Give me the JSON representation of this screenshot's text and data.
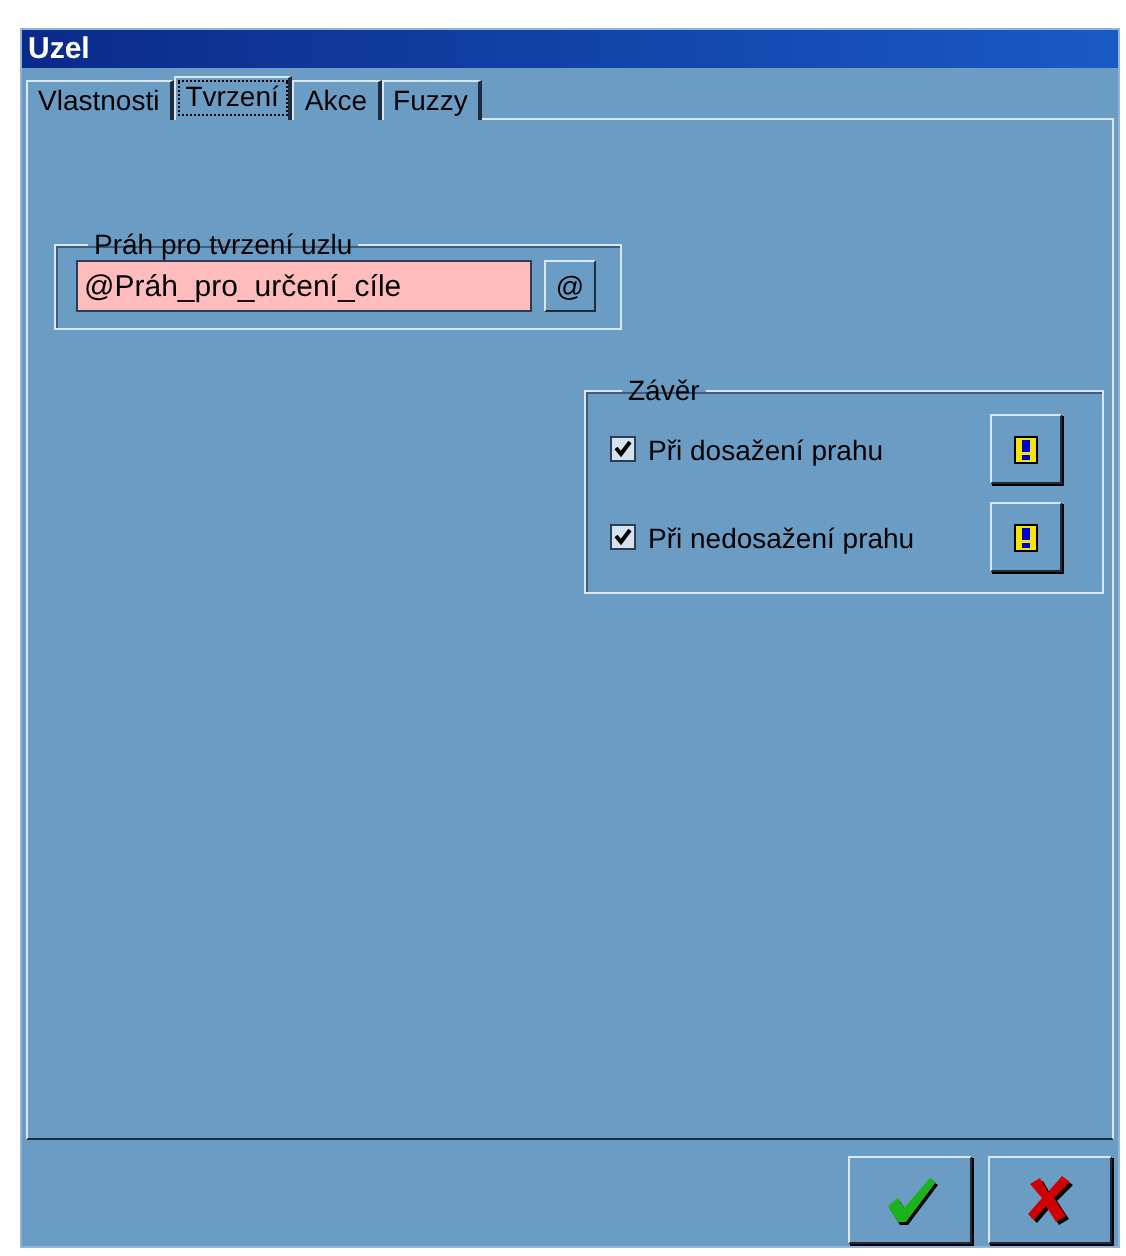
{
  "window": {
    "title": "Uzel"
  },
  "tabs": [
    {
      "label": "Vlastnosti",
      "selected": false
    },
    {
      "label": "Tvrzení",
      "selected": true
    },
    {
      "label": "Akce",
      "selected": false
    },
    {
      "label": "Fuzzy",
      "selected": false
    }
  ],
  "threshold_group": {
    "title": "Práh pro tvrzení uzlu",
    "field_value": "@Práh_pro_určení_cíle",
    "button_label": "@"
  },
  "conclusion_group": {
    "title": "Závěr",
    "options": [
      {
        "label": "Při dosažení prahu",
        "checked": true
      },
      {
        "label": "Při nedosažení prahu",
        "checked": true
      }
    ]
  },
  "buttons": [
    {
      "kind": "ok"
    },
    {
      "kind": "cancel"
    }
  ]
}
